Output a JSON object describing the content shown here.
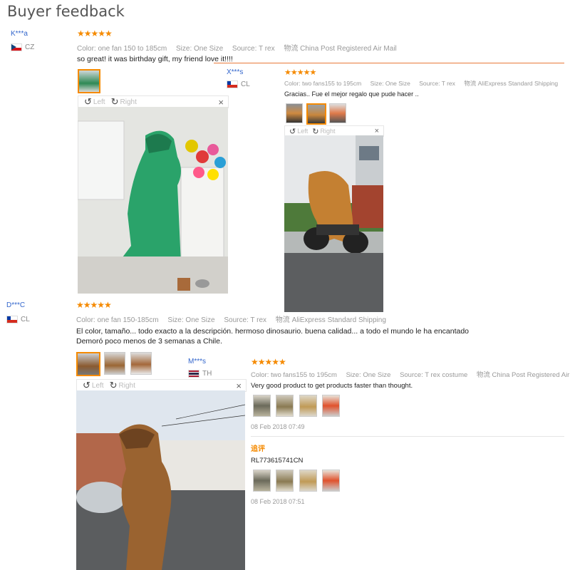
{
  "page": {
    "title": "Buyer feedback"
  },
  "reviews": [
    {
      "user": "K***a",
      "country": "CZ",
      "stars": "★★★★★",
      "color": "Color: one fan 150 to 185cm",
      "size": "Size: One Size",
      "source": "Source: T rex",
      "shipping": "物流 China Post Registered Air Mail",
      "text": "so great! it was birthday gift, my friend love it!!!!"
    },
    {
      "user": "X***s",
      "country": "CL",
      "stars": "★★★★★",
      "color": "Color: two fans155 to 195cm",
      "size": "Size: One Size",
      "source": "Source: T rex",
      "shipping": "物流 AliExpress Standard Shipping",
      "text": "Gracias.. Fue el mejor regalo que pude hacer .."
    },
    {
      "user": "D***C",
      "country": "CL",
      "stars": "★★★★★",
      "color": "Color: one fan 150-185cm",
      "size": "Size: One Size",
      "source": "Source: T rex",
      "shipping": "物流 AliExpress Standard Shipping",
      "text1": "El color, tamaño... todo exacto a la descripción. hermoso dinosaurio. buena calidad... a todo el mundo le ha encantado",
      "text2": "Demoró poco menos de 3 semanas a Chile."
    },
    {
      "user": "M***s",
      "country": "TH",
      "stars": "★★★★★",
      "color": "Color: two fans155 to 195cm",
      "size": "Size: One Size",
      "source": "Source: T rex costume",
      "shipping": "物流 China Post Registered Air Mail",
      "text": "Very good product to get products faster than thought.",
      "date": "08 Feb 2018 07:49",
      "followup_label": "追评",
      "followup_text": "RL773615741CN",
      "followup_date": "08 Feb 2018 07:51"
    }
  ],
  "viewer": {
    "left": "Left",
    "right": "Right",
    "close": "×"
  },
  "icons": {
    "rotate_left": "rotate-left-icon",
    "rotate_right": "rotate-right-icon"
  },
  "colors": {
    "accent": "#f58a00",
    "link": "#3366cc",
    "separator": "#e8793a"
  }
}
